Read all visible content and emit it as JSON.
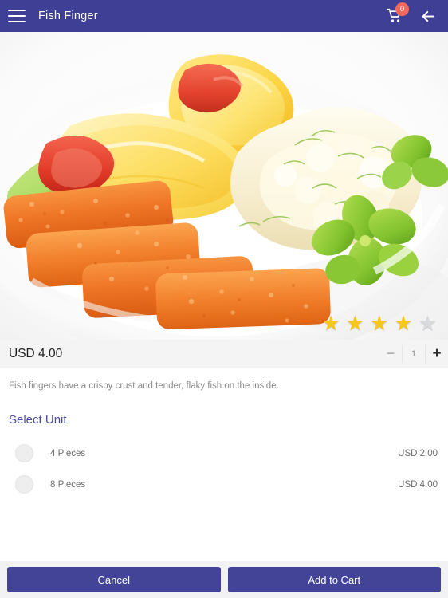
{
  "header": {
    "menu_icon": "hamburger-menu-icon",
    "title": "Fish Finger",
    "cart_icon": "shopping-cart-icon",
    "cart_badge": "0",
    "back_icon": "back-arrow-icon"
  },
  "hero": {
    "alt": "Plate of breaded fish fingers with mashed potato, lemon wedges, tomato and lettuce",
    "rating_value": 4,
    "rating_max": 5,
    "stars": [
      {
        "state": "filled",
        "glyph": "★"
      },
      {
        "state": "filled",
        "glyph": "★"
      },
      {
        "state": "filled",
        "glyph": "★"
      },
      {
        "state": "filled",
        "glyph": "★"
      },
      {
        "state": "empty",
        "glyph": "★"
      }
    ]
  },
  "price_bar": {
    "price": "USD 4.00",
    "decrement_label": "−",
    "quantity": "1",
    "increment_label": "+"
  },
  "description": "Fish fingers have a crispy crust and tender, flaky fish on the inside.",
  "select_unit": {
    "title": "Select Unit",
    "options": [
      {
        "label": "4 Pieces",
        "price": "USD 2.00",
        "selected": false
      },
      {
        "label": "8 Pieces",
        "price": "USD 4.00",
        "selected": false
      }
    ]
  },
  "footer": {
    "cancel_label": "Cancel",
    "add_to_cart_label": "Add to Cart"
  },
  "colors": {
    "appbar": "#3f4095",
    "accent": "#4d4da0",
    "button": "#434398",
    "badge": "#f4685d",
    "star_on": "#f7c71c",
    "star_off": "#d8dade",
    "pricebar_bg": "#f4f4f4",
    "footer_bg": "#f2f2f4"
  }
}
